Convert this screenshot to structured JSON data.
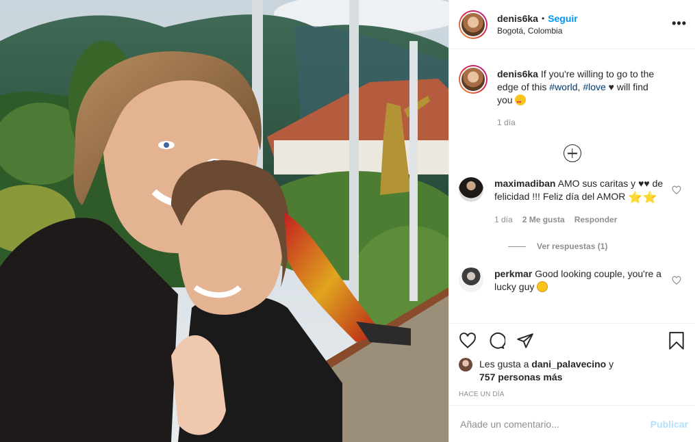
{
  "post": {
    "username": "denis6ka",
    "follow_label": "Seguir",
    "separator": "•",
    "location": "Bogotá, Colombia",
    "more_label": "•••"
  },
  "caption": {
    "username": "denis6ka",
    "text_1": " If you're willing to go to the edge of this ",
    "tag_1": "#world",
    "text_2": ", ",
    "tag_2": "#love",
    "text_3": " ♥ will find you ",
    "time": "1 día"
  },
  "comments": [
    {
      "username": "maximadiban",
      "text": " AMO sus caritas y ♥♥ de felicidad !!! Feliz día del AMOR ",
      "stars": "⭐⭐",
      "time": "1 día",
      "likes": "2 Me gusta",
      "reply": "Responder",
      "view_replies": "Ver respuestas (1)"
    },
    {
      "username": "perkmar",
      "text": " Good looking couple, you're a lucky guy "
    }
  ],
  "likes": {
    "prefix": "Les gusta a ",
    "user": "dani_palavecino",
    "suffix": " y",
    "count": "757 personas más"
  },
  "timestamp": "HACE UN DÍA",
  "add_comment": {
    "placeholder": "Añade un comentario...",
    "publish": "Publicar"
  },
  "colors": {
    "accent": "#0095f6",
    "publish_disabled": "#b2dffc",
    "hashtag": "#00376b",
    "muted": "#8e8e8e"
  },
  "icons": [
    "heart-icon",
    "comment-icon",
    "share-icon",
    "bookmark-icon",
    "add-replies-icon",
    "more-icon"
  ]
}
